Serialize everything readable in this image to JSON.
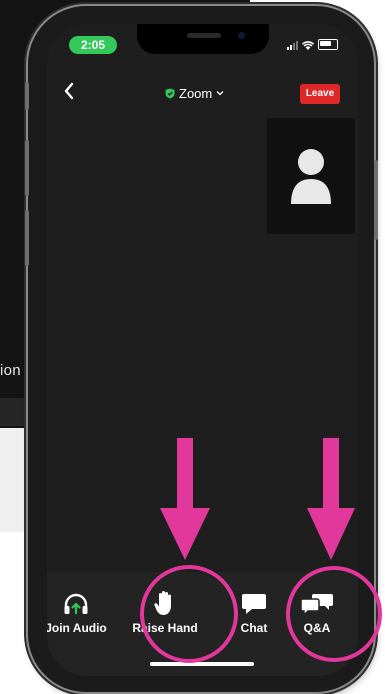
{
  "background": {
    "partial_text": "ion"
  },
  "status_bar": {
    "time": "2:05",
    "icons": [
      "signal-icon",
      "wifi-icon",
      "battery-icon"
    ]
  },
  "header": {
    "back_icon": "chevron-left-icon",
    "title": "Zoom",
    "shield_icon": "shield-check-icon",
    "dropdown_icon": "chevron-down-icon",
    "leave_label": "Leave"
  },
  "video_thumbnail": {
    "icon": "person-avatar-icon"
  },
  "toolbar": {
    "items": [
      {
        "label": "Join Audio",
        "icon": "headphones-icon"
      },
      {
        "label": "Raise Hand",
        "icon": "hand-icon"
      },
      {
        "label": "Chat",
        "icon": "chat-bubble-icon"
      },
      {
        "label": "Q&A",
        "icon": "qa-bubbles-icon"
      }
    ]
  },
  "annotations": {
    "color": "#e2379b"
  },
  "colors": {
    "leave": "#e02828",
    "time_pill": "#34c759",
    "join_audio_arrow": "#34c759",
    "annotation": "#e2379b"
  }
}
